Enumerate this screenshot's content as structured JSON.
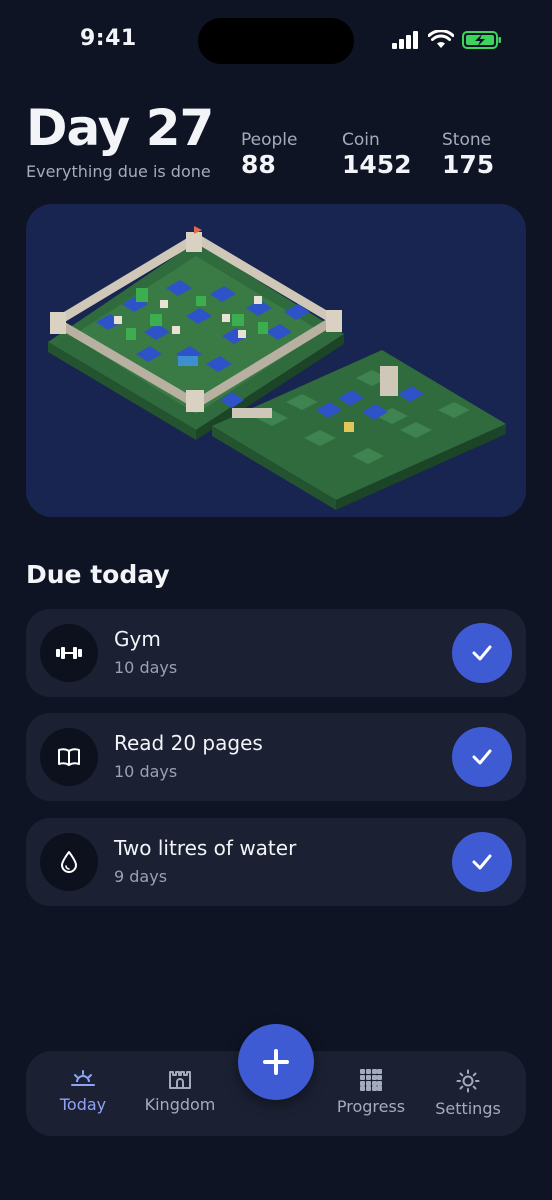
{
  "status_bar": {
    "time": "9:41"
  },
  "header": {
    "title": "Day 27",
    "subtitle": "Everything due is done",
    "stats": [
      {
        "label": "People",
        "value": "88"
      },
      {
        "label": "Coin",
        "value": "1452"
      },
      {
        "label": "Stone",
        "value": "175"
      }
    ]
  },
  "due_section": {
    "title": "Due today"
  },
  "tasks": [
    {
      "name": "Gym",
      "streak": "10 days",
      "icon": "dumbbell-icon",
      "done": true
    },
    {
      "name": "Read 20 pages",
      "streak": "10 days",
      "icon": "book-icon",
      "done": true
    },
    {
      "name": "Two litres of water",
      "streak": "9 days",
      "icon": "water-drop-icon",
      "done": true
    }
  ],
  "tabbar": {
    "tabs": [
      {
        "label": "Today",
        "icon": "sunrise-icon",
        "active": true
      },
      {
        "label": "Kingdom",
        "icon": "castle-icon",
        "active": false
      },
      {
        "label": "Progress",
        "icon": "grid-icon",
        "active": false
      },
      {
        "label": "Settings",
        "icon": "sun-gear-icon",
        "active": false
      }
    ],
    "add_button_icon": "plus-icon"
  },
  "colors": {
    "background": "#0f1424",
    "card": "#1b2133",
    "kingdom_card": "#172550",
    "accent": "#3f5bd3",
    "active_tab": "#8fa2f5"
  }
}
